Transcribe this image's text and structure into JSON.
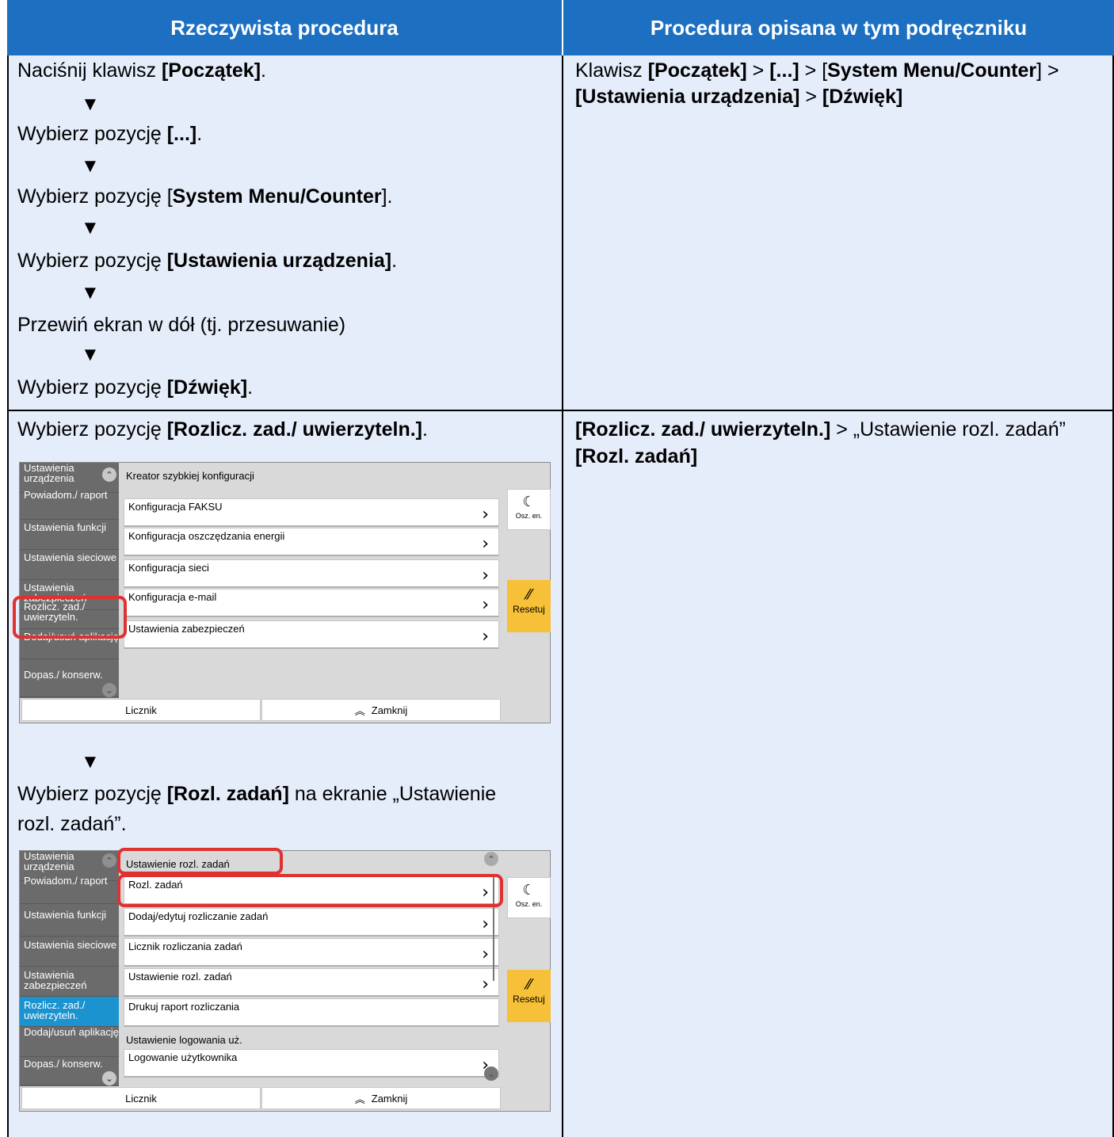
{
  "header": {
    "left": "Rzeczywista procedura",
    "right": "Procedura opisana w tym podręczniku"
  },
  "row1": {
    "steps": [
      {
        "pre": "Naciśnij klawisz ",
        "bold": "[Początek]",
        "post": "."
      },
      {
        "pre": "Wybierz pozycję ",
        "bold": "[...]",
        "post": "."
      },
      {
        "pre": "Wybierz pozycję [",
        "bold": "System Menu/Counter",
        "post": "]."
      },
      {
        "pre": "Wybierz pozycję ",
        "bold": "[Ustawienia urządzenia]",
        "post": "."
      },
      {
        "pre": "Przewiń ekran w dół (tj. przesuwanie)",
        "bold": "",
        "post": ""
      },
      {
        "pre": "Wybierz pozycję ",
        "bold": "[Dźwięk]",
        "post": "."
      }
    ],
    "arrow": "▼",
    "right_line1": {
      "a": "Klawisz ",
      "b": "[Początek]",
      "c": " > ",
      "d": "[...]",
      "e": " > [",
      "f": "System Menu/Counter",
      "g": "] >"
    },
    "right_line2": {
      "a": "[Ustawienia urządzenia]",
      "b": " > ",
      "c": "[Dźwięk]"
    }
  },
  "row2": {
    "step1": {
      "pre": "Wybierz pozycję ",
      "bold": "[Rozlicz. zad./ uwierzyteln.]",
      "post": "."
    },
    "step2_line1": {
      "pre": "Wybierz pozycję ",
      "bold": "[Rozl. zadań]",
      "post": " na ekranie „Ustawienie"
    },
    "step2_line2": "rozl. zadań”.",
    "right_line1": {
      "a": "[Rozlicz. zad./ uwierzyteln.]",
      "b": " > „Ustawienie rozl. zadań”"
    },
    "right_line2": "[Rozl. zadań]"
  },
  "screen1": {
    "side": [
      "Ustawienia urządzenia",
      "Powiadom./ raport",
      "Ustawienia funkcji",
      "Ustawienia sieciowe",
      "Ustawienia zabezpieczeń",
      "Rozlicz. zad./ uwierzyteln.",
      "Dodaj/usuń aplikację",
      "Dopas./ konserw."
    ],
    "section": "Kreator szybkiej konfiguracji",
    "items": [
      "Konfiguracja FAKSU",
      "Konfiguracja oszczędzania energii",
      "Konfiguracja sieci",
      "Konfiguracja e-mail",
      "Ustawienia zabezpieczeń"
    ],
    "sleep": "Osz. en.",
    "reset": "Resetuj",
    "counter": "Licznik",
    "close": "Zamknij"
  },
  "screen2": {
    "side": [
      "Ustawienia urządzenia",
      "Powiadom./ raport",
      "Ustawienia funkcji",
      "Ustawienia sieciowe",
      "Ustawienia zabezpieczeń",
      "Rozlicz. zad./ uwierzyteln.",
      "Dodaj/usuń aplikację",
      "Dopas./ konserw."
    ],
    "section1": "Ustawienie rozl. zadań",
    "items": [
      "Rozl. zadań",
      "Dodaj/edytuj rozliczanie zadań",
      "Licznik rozliczania zadań",
      "Ustawienie rozl. zadań",
      "Drukuj raport rozliczania"
    ],
    "section2": "Ustawienie logowania uż.",
    "items2": [
      "Logowanie użytkownika"
    ],
    "sleep": "Osz. en.",
    "reset": "Resetuj",
    "counter": "Licznik",
    "close": "Zamknij"
  },
  "icons": {
    "chevron": "›",
    "moon": "☾",
    "reset": "⁄⁄",
    "close": "︽",
    "up": "⌃",
    "down": "⌄"
  }
}
